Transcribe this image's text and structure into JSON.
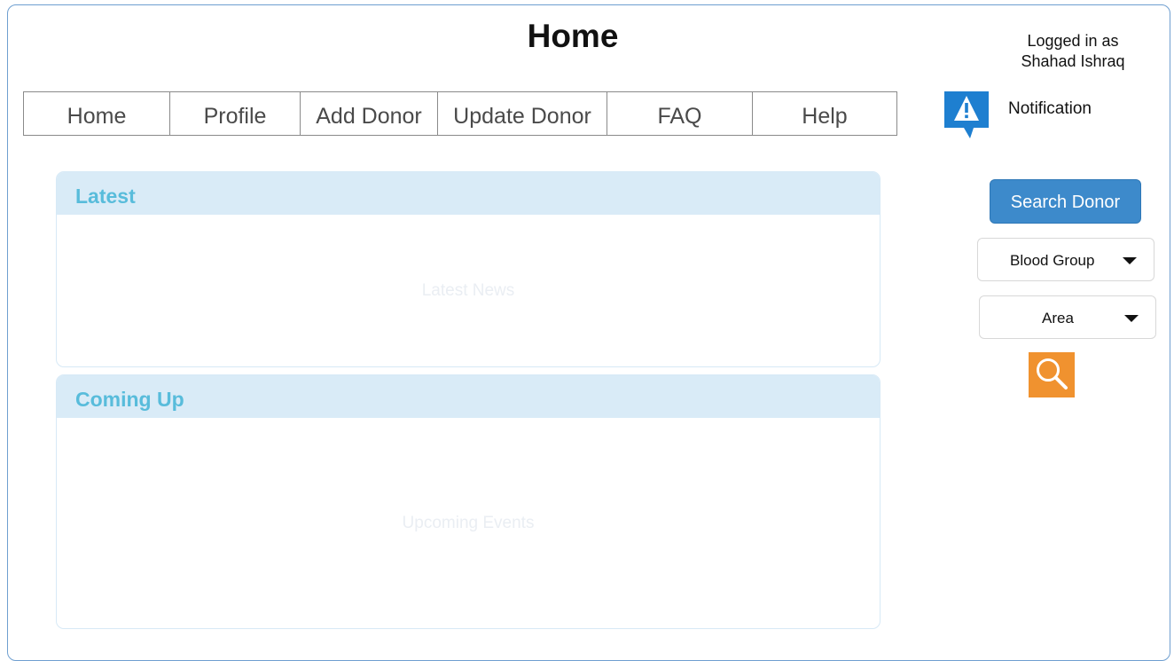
{
  "header": {
    "title": "Home",
    "user": {
      "line1": "Logged in as",
      "line2": "Shahad Ishraq"
    },
    "notification_label": "Notification"
  },
  "nav": {
    "items": [
      {
        "label": "Home"
      },
      {
        "label": "Profile"
      },
      {
        "label": "Add Donor"
      },
      {
        "label": "Update Donor"
      },
      {
        "label": "FAQ"
      },
      {
        "label": "Help"
      }
    ]
  },
  "panels": {
    "latest": {
      "title": "Latest",
      "placeholder": "Latest News"
    },
    "coming_up": {
      "title": "Coming Up",
      "placeholder": "Upcoming Events"
    }
  },
  "search": {
    "button_label": "Search Donor",
    "blood_group_select": "Blood Group",
    "area_select": "Area"
  },
  "icons": {
    "notification": "warning-speech-bubble-icon",
    "search": "magnifier-icon",
    "dropdown": "caret-down-icon"
  },
  "colors": {
    "accent_blue": "#3d8acb",
    "panel_header_bg": "#d9ebf7",
    "panel_title": "#58bcdb",
    "search_icon_bg": "#f0922f",
    "notification_icon": "#1e7fd0"
  }
}
